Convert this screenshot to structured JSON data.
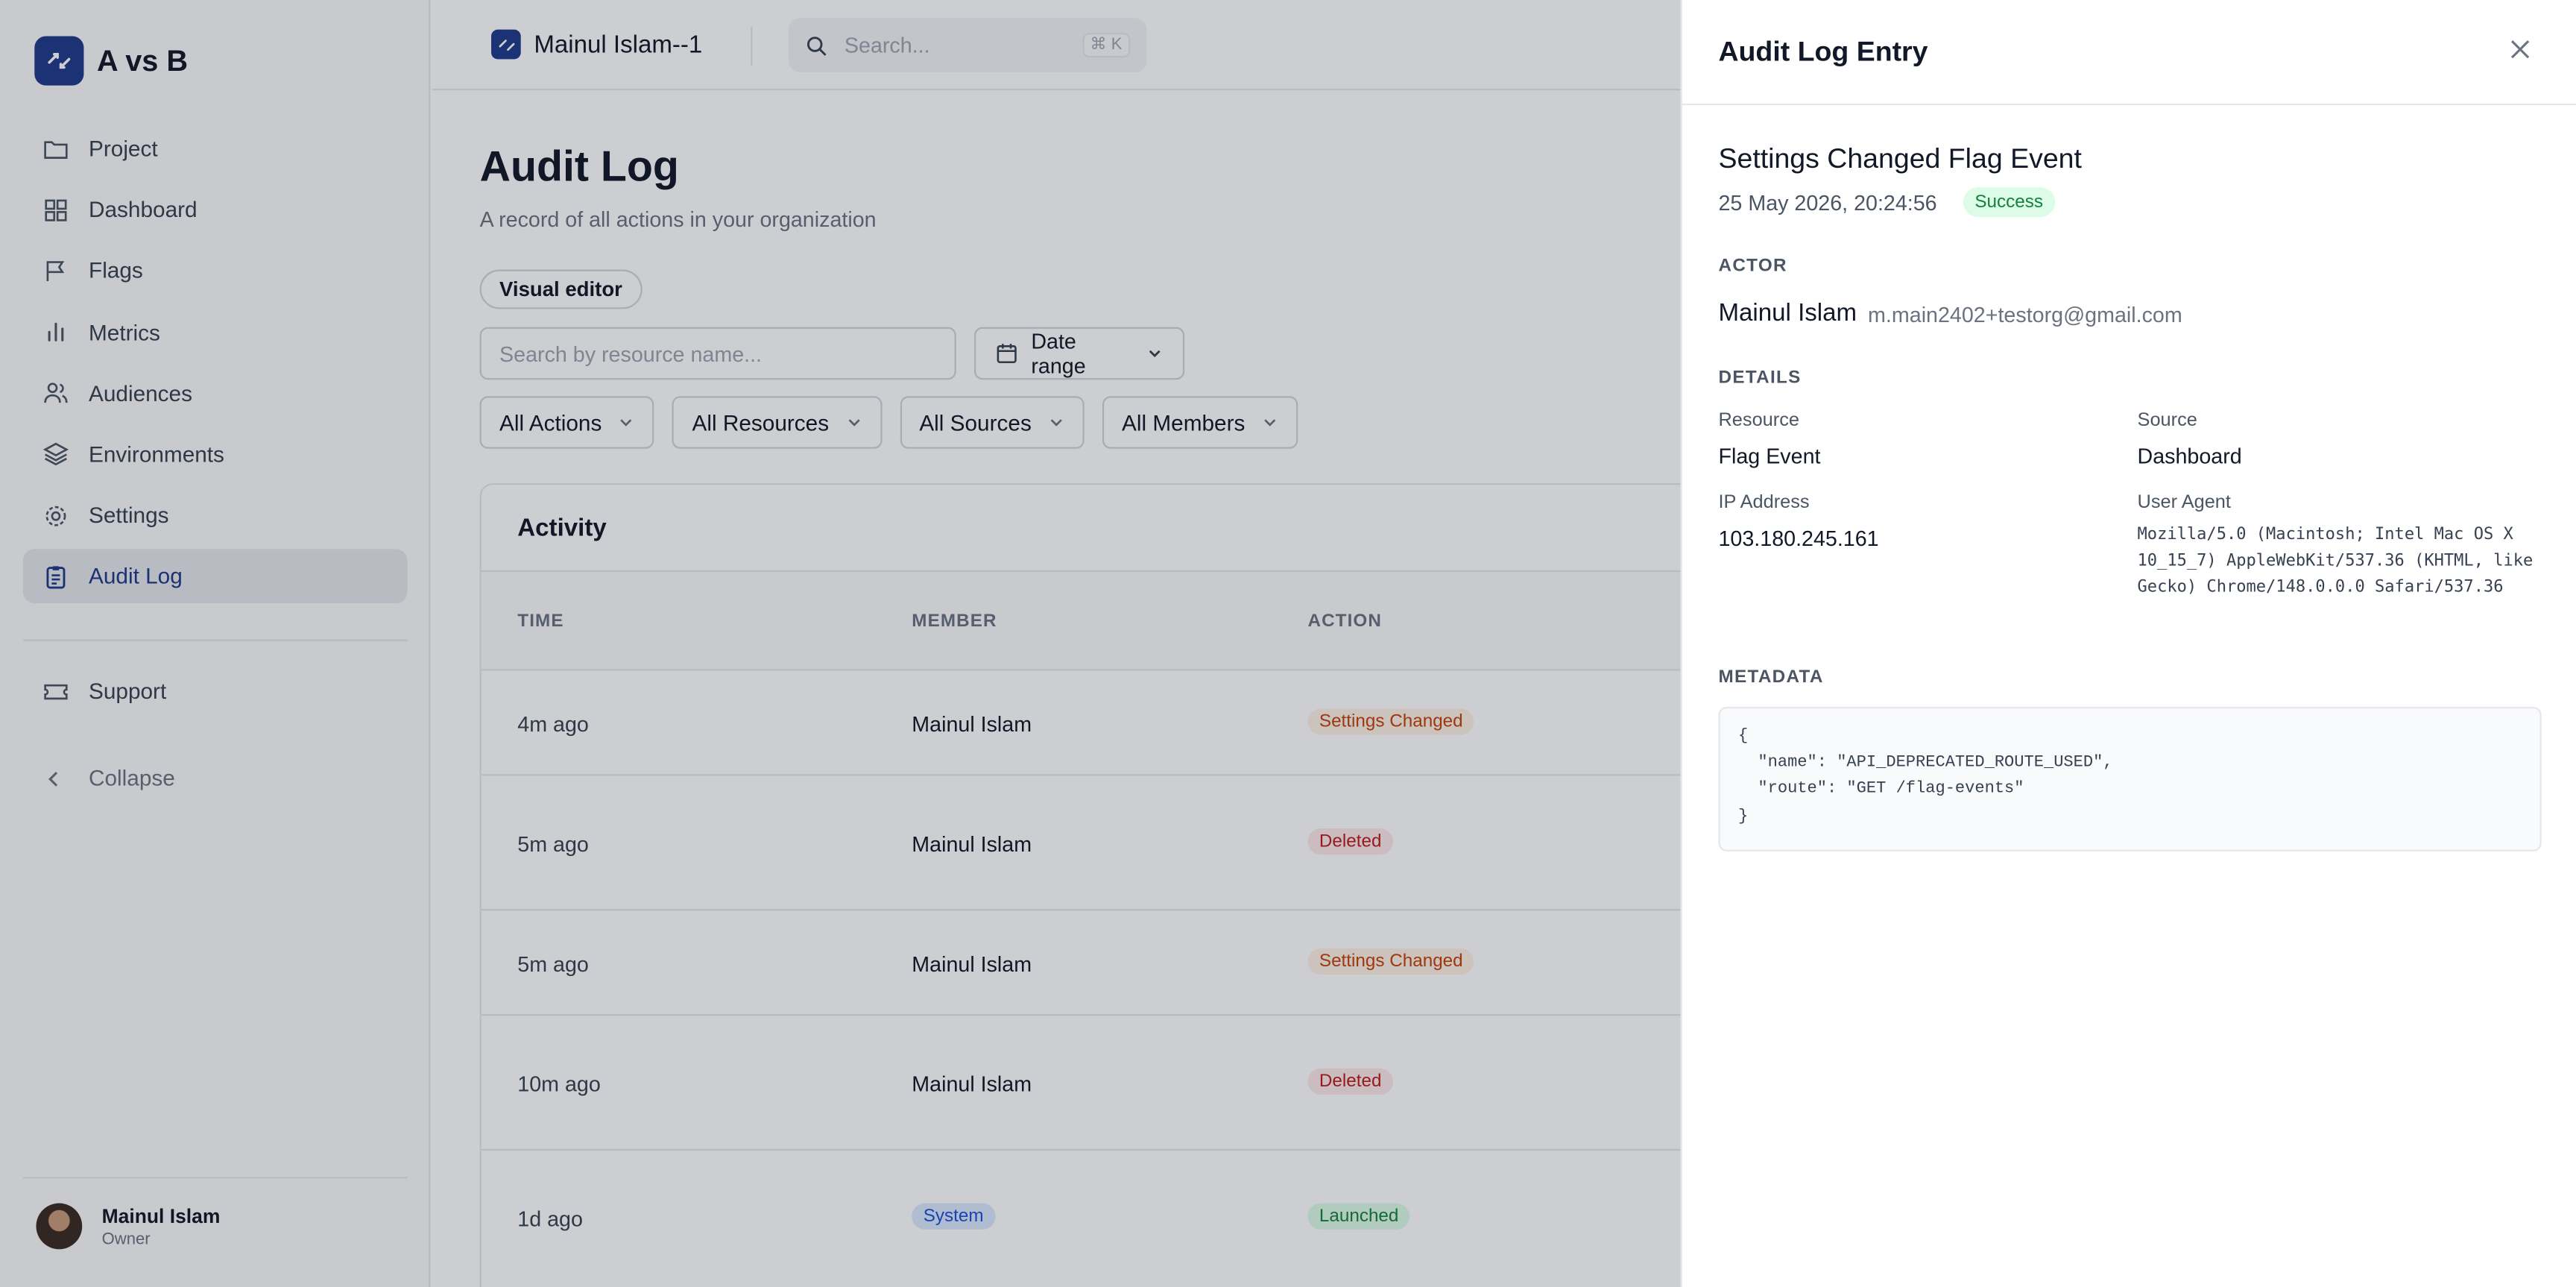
{
  "app": {
    "brand": "A vs B",
    "project": "Mainul Islam--1",
    "search_placeholder": "Search...",
    "search_shortcut": "⌘ K"
  },
  "sidebar": {
    "items": [
      {
        "label": "Project",
        "icon": "folder-icon"
      },
      {
        "label": "Dashboard",
        "icon": "grid-icon"
      },
      {
        "label": "Flags",
        "icon": "flag-icon"
      },
      {
        "label": "Metrics",
        "icon": "bar-chart-icon"
      },
      {
        "label": "Audiences",
        "icon": "users-icon"
      },
      {
        "label": "Environments",
        "icon": "layers-icon"
      },
      {
        "label": "Settings",
        "icon": "gear-icon"
      },
      {
        "label": "Audit Log",
        "icon": "clipboard-icon",
        "active": true
      }
    ],
    "support": "Support",
    "collapse": "Collapse",
    "user": {
      "name": "Mainul Islam",
      "role": "Owner"
    }
  },
  "main": {
    "title": "Audit Log",
    "subtitle": "A record of all actions in your organization",
    "chip": "Visual editor",
    "search_placeholder": "Search by resource name...",
    "date_range": "Date range",
    "filters": [
      "All Actions",
      "All Resources",
      "All Sources",
      "All Members"
    ],
    "card_title": "Activity",
    "columns": [
      "TIME",
      "MEMBER",
      "ACTION"
    ],
    "rows": [
      {
        "time": "4m ago",
        "member": "Mainul Islam",
        "action": "Settings Changed",
        "tone": "orange"
      },
      {
        "time": "5m ago",
        "member": "Mainul Islam",
        "action": "Deleted",
        "tone": "red"
      },
      {
        "time": "5m ago",
        "member": "Mainul Islam",
        "action": "Settings Changed",
        "tone": "orange"
      },
      {
        "time": "10m ago",
        "member": "Mainul Islam",
        "action": "Deleted",
        "tone": "red"
      },
      {
        "time": "1d ago",
        "member": "System",
        "action": "Launched",
        "tone": "green",
        "member_badge": true
      }
    ]
  },
  "drawer": {
    "title": "Audit Log Entry",
    "event_title": "Settings Changed Flag Event",
    "timestamp": "25 May 2026, 20:24:56",
    "status": "Success",
    "actor_label": "ACTOR",
    "actor_name": "Mainul Islam",
    "actor_email": "m.main2402+testorg@gmail.com",
    "details_label": "DETAILS",
    "resource_label": "Resource",
    "resource": "Flag Event",
    "source_label": "Source",
    "source": "Dashboard",
    "ip_label": "IP Address",
    "ip": "103.180.245.161",
    "ua_label": "User Agent",
    "user_agent": "Mozilla/5.0 (Macintosh; Intel Mac OS X 10_15_7) AppleWebKit/537.36 (KHTML, like Gecko) Chrome/148.0.0.0 Safari/537.36",
    "metadata_label": "METADATA",
    "metadata": "{\n  \"name\": \"API_DEPRECATED_ROUTE_USED\",\n  \"route\": \"GET /flag-events\"\n}"
  }
}
